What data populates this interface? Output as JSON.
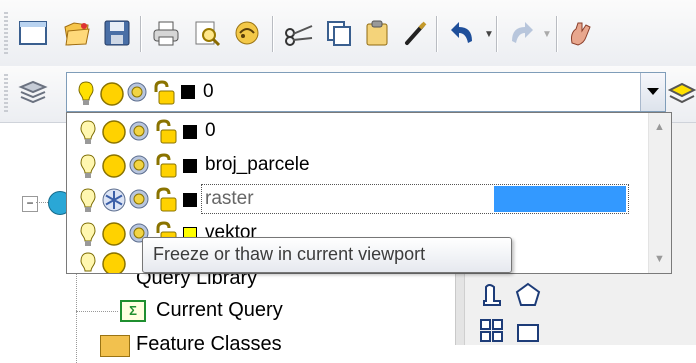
{
  "toolbar_top": {
    "buttons": [
      "new-icon",
      "open-icon",
      "save-icon",
      "print-icon",
      "plot-preview-icon",
      "publish-icon",
      "cut-icon",
      "copy-icon",
      "paste-icon",
      "match-properties-icon",
      "undo-icon",
      "redo-icon",
      "pan-icon"
    ]
  },
  "layer_combo": {
    "current_layer": "0"
  },
  "layer_list": {
    "rows": [
      {
        "name": "0",
        "color": "#000000",
        "freeze": "sun"
      },
      {
        "name": "broj_parcele",
        "color": "#000000",
        "freeze": "sun"
      },
      {
        "name": "raster",
        "color": "#000000",
        "freeze": "snowflake",
        "editing": true
      },
      {
        "name": "vektor",
        "color": "#ffff00",
        "freeze": "sun"
      },
      {
        "name": "",
        "color": "#000000",
        "freeze": "sun"
      }
    ]
  },
  "tooltip": {
    "text": "Freeze or thaw in current viewport"
  },
  "tree": {
    "collapse_sign": "⊟",
    "items": [
      {
        "label": "Query Library"
      },
      {
        "label": "Current Query"
      },
      {
        "label": "Feature Classes"
      }
    ]
  },
  "colors": {
    "selection": "#3399ff",
    "bulb": "#ffe100",
    "sun": "#ffd200"
  }
}
